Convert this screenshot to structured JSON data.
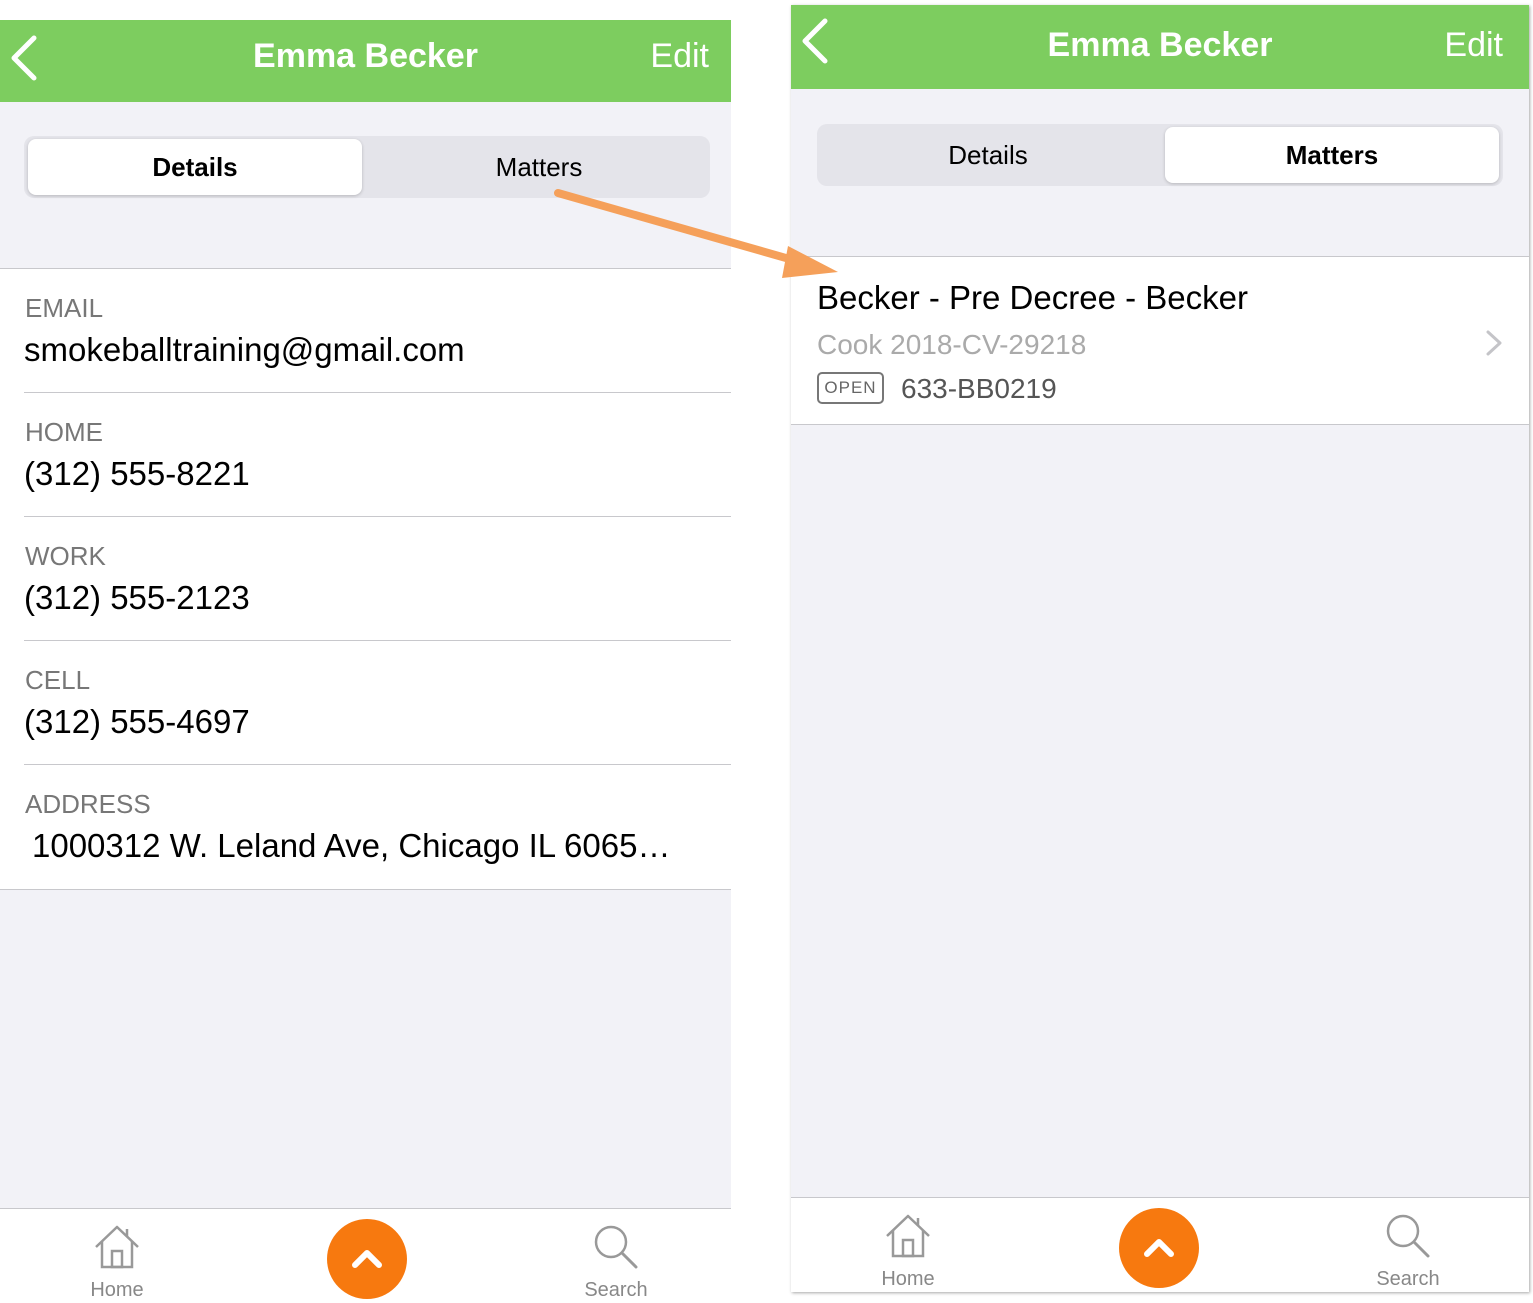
{
  "left_screen": {
    "navbar": {
      "title": "Emma Becker",
      "edit_label": "Edit"
    },
    "segments": {
      "details": "Details",
      "matters": "Matters",
      "active": "details"
    },
    "details": [
      {
        "label": "EMAIL",
        "value": "smokeballtraining@gmail.com"
      },
      {
        "label": "HOME",
        "value": "(312) 555-8221"
      },
      {
        "label": "WORK",
        "value": "(312) 555-2123"
      },
      {
        "label": "CELL",
        "value": "(312) 555-4697"
      },
      {
        "label": "ADDRESS",
        "value": "1000312 W. Leland Ave,  Chicago IL 6065…"
      }
    ],
    "tabbar": {
      "home": "Home",
      "search": "Search"
    }
  },
  "right_screen": {
    "navbar": {
      "title": "Emma Becker",
      "edit_label": "Edit"
    },
    "segments": {
      "details": "Details",
      "matters": "Matters",
      "active": "matters"
    },
    "matters": [
      {
        "title": "Becker - Pre Decree - Becker",
        "subtitle": "Cook 2018-CV-29218",
        "status": "OPEN",
        "number": "633-BB0219"
      }
    ],
    "tabbar": {
      "home": "Home",
      "search": "Search"
    }
  },
  "colors": {
    "navbar": "#7dcd5f",
    "fab": "#f7790f",
    "annotation_arrow": "#f5a05a",
    "background": "#f2f2f7"
  },
  "icons": {
    "back": "chevron-left-icon",
    "home": "house-icon",
    "search": "magnifier-icon",
    "fab": "chevron-up-icon",
    "row": "chevron-right-icon"
  }
}
